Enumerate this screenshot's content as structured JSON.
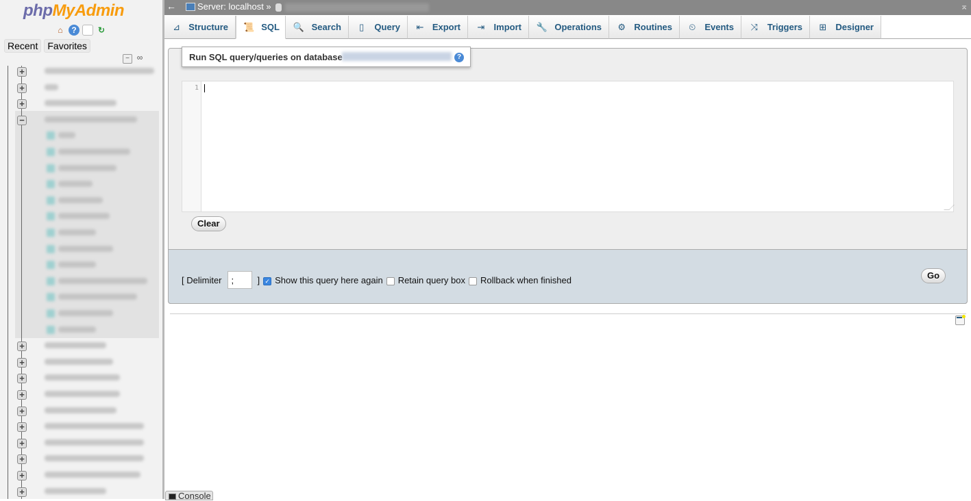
{
  "sidebar": {
    "logo_php": "php",
    "logo_myadmin": "MyAdmin",
    "icons": [
      "home-icon",
      "help-icon",
      "documentation-icon",
      "reload-icon"
    ],
    "tabs": [
      "Recent",
      "Favorites"
    ],
    "tree": {
      "collapsed_before": 3,
      "expanded_db_children": 13,
      "collapsed_after": 10
    }
  },
  "topbar": {
    "back": "←",
    "server_label": "Server: localhost »",
    "collapse": "⌅"
  },
  "tabs": [
    {
      "label": "Structure",
      "icon": "structure-icon",
      "glyph": "⊿",
      "active": false
    },
    {
      "label": "SQL",
      "icon": "sql-icon",
      "glyph": "📜",
      "active": true
    },
    {
      "label": "Search",
      "icon": "search-icon",
      "glyph": "🔍",
      "active": false
    },
    {
      "label": "Query",
      "icon": "query-icon",
      "glyph": "▯",
      "active": false
    },
    {
      "label": "Export",
      "icon": "export-icon",
      "glyph": "⇤",
      "active": false
    },
    {
      "label": "Import",
      "icon": "import-icon",
      "glyph": "⇥",
      "active": false
    },
    {
      "label": "Operations",
      "icon": "wrench-icon",
      "glyph": "🔧",
      "active": false
    },
    {
      "label": "Routines",
      "icon": "routines-icon",
      "glyph": "⚙",
      "active": false
    },
    {
      "label": "Events",
      "icon": "events-icon",
      "glyph": "⏲",
      "active": false
    },
    {
      "label": "Triggers",
      "icon": "triggers-icon",
      "glyph": "⤨",
      "active": false
    },
    {
      "label": "Designer",
      "icon": "designer-icon",
      "glyph": "⊞",
      "active": false
    }
  ],
  "sql_panel": {
    "legend": "Run SQL query/queries on database",
    "editor_line_number": "1",
    "editor_value": "",
    "clear_label": "Clear",
    "delimiter_label_open": "[ Delimiter",
    "delimiter_value": ";",
    "delimiter_label_close": "]",
    "options": [
      {
        "label": "Show this query here again",
        "checked": true
      },
      {
        "label": "Retain query box",
        "checked": false
      },
      {
        "label": "Rollback when finished",
        "checked": false
      }
    ],
    "go_label": "Go"
  },
  "console": {
    "label": "Console"
  }
}
